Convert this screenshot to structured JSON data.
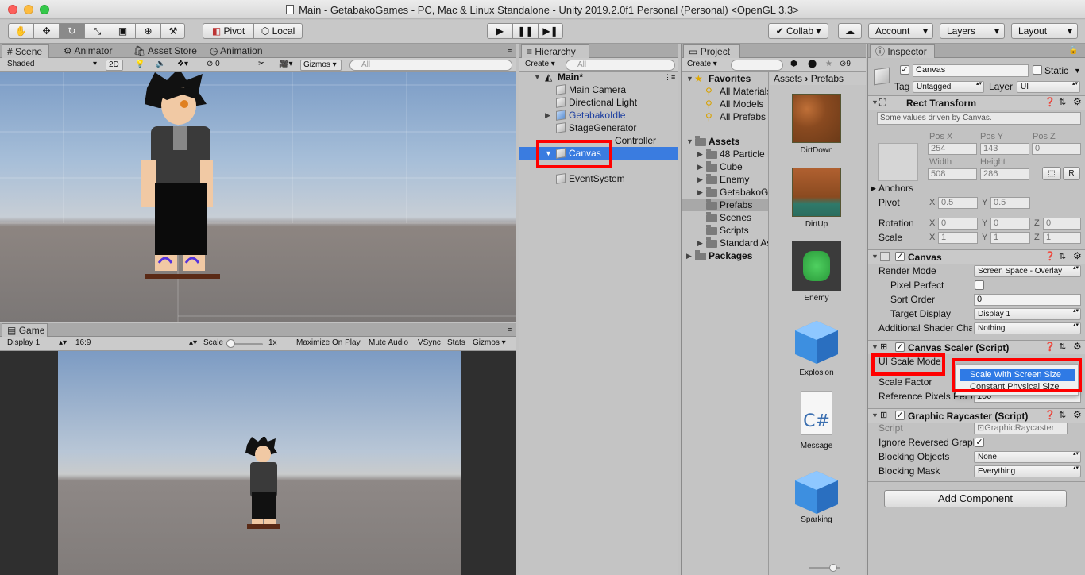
{
  "window": {
    "title": "Main - GetabakoGames - PC, Mac & Linux Standalone - Unity 2019.2.0f1 Personal (Personal) <OpenGL 3.3>"
  },
  "toolbar": {
    "pivot": "Pivot",
    "local": "Local",
    "collab": "Collab",
    "account": "Account",
    "layers": "Layers",
    "layout": "Layout"
  },
  "scene": {
    "tabs": [
      "Scene",
      "Animator",
      "Asset Store",
      "Animation"
    ],
    "shading": "Shaded",
    "mode_2d": "2D",
    "effects_count": "0",
    "gizmos": "Gizmos",
    "search_placeholder": "All"
  },
  "game": {
    "tab": "Game",
    "display": "Display 1",
    "aspect": "16:9",
    "scale_label": "Scale",
    "scale_value": "1x",
    "buttons": [
      "Maximize On Play",
      "Mute Audio",
      "VSync",
      "Stats",
      "Gizmos"
    ]
  },
  "hierarchy": {
    "tab": "Hierarchy",
    "create": "Create",
    "search_placeholder": "All",
    "scene": "Main*",
    "items": [
      "Main Camera",
      "Directional Light",
      "GetabakoIdle",
      "StageGenerator",
      "Controller",
      "Canvas",
      "EventSystem"
    ],
    "selected": "Canvas"
  },
  "project": {
    "tab": "Project",
    "create": "Create",
    "hidden_count": "9",
    "favorites": {
      "label": "Favorites",
      "items": [
        "All Materials",
        "All Models",
        "All Prefabs"
      ]
    },
    "assets": {
      "label": "Assets",
      "folders": [
        "48 Particle E",
        "Cube",
        "Enemy",
        "GetabakoGa",
        "Prefabs",
        "Scenes",
        "Scripts",
        "Standard As"
      ]
    },
    "packages": "Packages",
    "breadcrumb": [
      "Assets",
      "Prefabs"
    ],
    "prefabs": [
      "DirtDown",
      "DirtUp",
      "Enemy",
      "Explosion",
      "Message",
      "Sparking"
    ]
  },
  "inspector": {
    "tab": "Inspector",
    "object_name": "Canvas",
    "static_label": "Static",
    "tag_label": "Tag",
    "tag_value": "Untagged",
    "layer_label": "Layer",
    "layer_value": "UI",
    "rect_transform": {
      "title": "Rect Transform",
      "note": "Some values driven by Canvas.",
      "pos_x_label": "Pos X",
      "pos_y_label": "Pos Y",
      "pos_z_label": "Pos Z",
      "pos_x": "254",
      "pos_y": "143",
      "pos_z": "0",
      "width_label": "Width",
      "height_label": "Height",
      "width": "508",
      "height": "286",
      "r_button": "R",
      "anchors": "Anchors",
      "pivot_label": "Pivot",
      "pivot_x": "0.5",
      "pivot_y": "0.5",
      "rotation_label": "Rotation",
      "rot_x": "0",
      "rot_y": "0",
      "rot_z": "0",
      "scale_label": "Scale",
      "scale_x": "1",
      "scale_y": "1",
      "scale_z": "1",
      "x": "X",
      "y": "Y",
      "z": "Z"
    },
    "canvas": {
      "title": "Canvas",
      "render_mode_label": "Render Mode",
      "render_mode": "Screen Space - Overlay",
      "pixel_perfect": "Pixel Perfect",
      "sort_order_label": "Sort Order",
      "sort_order": "0",
      "target_display_label": "Target Display",
      "target_display": "Display 1",
      "shader_label": "Additional Shader Cha",
      "shader_value": "Nothing"
    },
    "canvas_scaler": {
      "title": "Canvas Scaler (Script)",
      "ui_scale_mode": "UI Scale Mode",
      "scale_factor": "Scale Factor",
      "ref_pixels": "Reference Pixels Per U",
      "ref_value": "100",
      "dropdown_selected": "Scale With Screen Size",
      "dropdown_next": "Constant Physical Size"
    },
    "graphic_raycaster": {
      "title": "Graphic Raycaster (Script)",
      "script_label": "Script",
      "script_value": "GraphicRaycaster",
      "ignore_reversed": "Ignore Reversed Graph",
      "blocking_objects_label": "Blocking Objects",
      "blocking_objects": "None",
      "blocking_mask_label": "Blocking Mask",
      "blocking_mask": "Everything"
    },
    "add_component": "Add Component"
  },
  "colors": {
    "selection": "#3a7ce0",
    "highlight": "#ff0000",
    "panel": "#c2c2c2"
  }
}
